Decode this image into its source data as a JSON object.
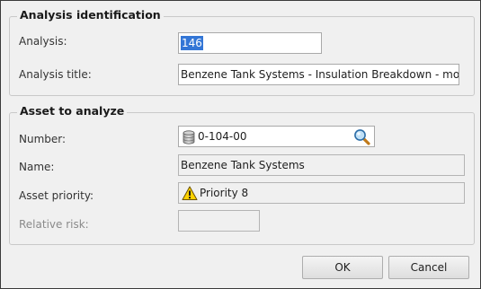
{
  "analysis_identification": {
    "title": "Analysis identification",
    "analysis_label": "Analysis:",
    "analysis_value": "146",
    "analysis_title_label": "Analysis title:",
    "analysis_title_value": "Benzene Tank Systems - Insulation Breakdown - mo"
  },
  "asset_to_analyze": {
    "title": "Asset to analyze",
    "number_label": "Number:",
    "number_value": "0-104-00",
    "number_icon": "database-icon",
    "number_action_icon": "magnifier-search-icon",
    "name_label": "Name:",
    "name_value": "Benzene Tank Systems",
    "priority_label": "Asset priority:",
    "priority_value": "Priority 8",
    "priority_icon": "warning-triangle-icon",
    "relative_risk_label": "Relative risk:",
    "relative_risk_value": ""
  },
  "buttons": {
    "ok_label": "OK",
    "cancel_label": "Cancel"
  },
  "colors": {
    "dialog_background": "#f0f0f0",
    "selection_highlight": "#3376d6",
    "warning_yellow": "#ffd200"
  }
}
